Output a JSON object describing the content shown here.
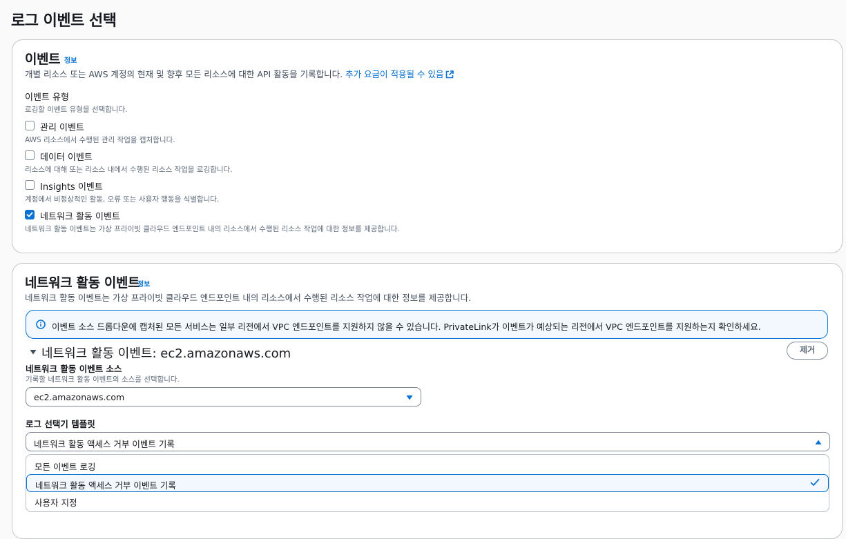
{
  "page_title": "로그 이벤트 선택",
  "events_card": {
    "title": "이벤트",
    "info": "정보",
    "description": "개별 리소스 또는 AWS 계정의 현재 및 향후 모든 리소스에 대한 API 활동을 기록합니다.",
    "pricing_link": "추가 요금이 적용될 수 있음",
    "type_label": "이벤트 유형",
    "type_hint": "로깅할 이벤트 유형을 선택합니다.",
    "options": [
      {
        "label": "관리 이벤트",
        "desc": "AWS 리소스에서 수행된 관리 작업을 캡처합니다.",
        "checked": false
      },
      {
        "label": "데이터 이벤트",
        "desc": "리소스에 대해 또는 리소스 내에서 수행된 리소스 작업을 로깅합니다.",
        "checked": false
      },
      {
        "label": "Insights 이벤트",
        "desc": "계정에서 비정상적인 활동, 오류 또는 사용자 행동을 식별합니다.",
        "checked": false
      },
      {
        "label": "네트워크 활동 이벤트",
        "desc": "네트워크 활동 이벤트는 가상 프라이빗 클라우드 엔드포인트 내의 리소스에서 수행된 리소스 작업에 대한 정보를 제공합니다.",
        "checked": true
      }
    ]
  },
  "network_card": {
    "title": "네트워크 활동 이벤트",
    "info": "정보",
    "description": "네트워크 활동 이벤트는 가상 프라이빗 클라우드 엔드포인트 내의 리소스에서 수행된 리소스 작업에 대한 정보를 제공합니다.",
    "alert": "이벤트 소스 드롭다운에 캡처된 모든 서비스는 일부 리전에서 VPC 엔드포인트를 지원하지 않을 수 있습니다. PrivateLink가 이벤트가 예상되는 리전에서 VPC 엔드포인트를 지원하는지 확인하세요.",
    "section_title": "네트워크 활동 이벤트: ec2.amazonaws.com",
    "remove_button": "제거",
    "source_label": "네트워크 활동 이벤트 소스",
    "source_hint": "기록할 네트워크 활동 이벤트의 소스를 선택합니다.",
    "source_value": "ec2.amazonaws.com",
    "template_label": "로그 선택기 템플릿",
    "template_value": "네트워크 활동 액세스 거부 이벤트 기록",
    "template_options": [
      "모든 이벤트 로깅",
      "네트워크 활동 액세스 거부 이벤트 기록",
      "사용자 지정"
    ],
    "selected_option_index": 1
  },
  "colors": {
    "accent": "#0972d3",
    "border": "#7d8998",
    "alert_bg": "#f2f8fd"
  },
  "icons": [
    "external-link-icon",
    "info-circle-icon",
    "caret-down-icon",
    "caret-up-icon",
    "check-icon"
  ]
}
